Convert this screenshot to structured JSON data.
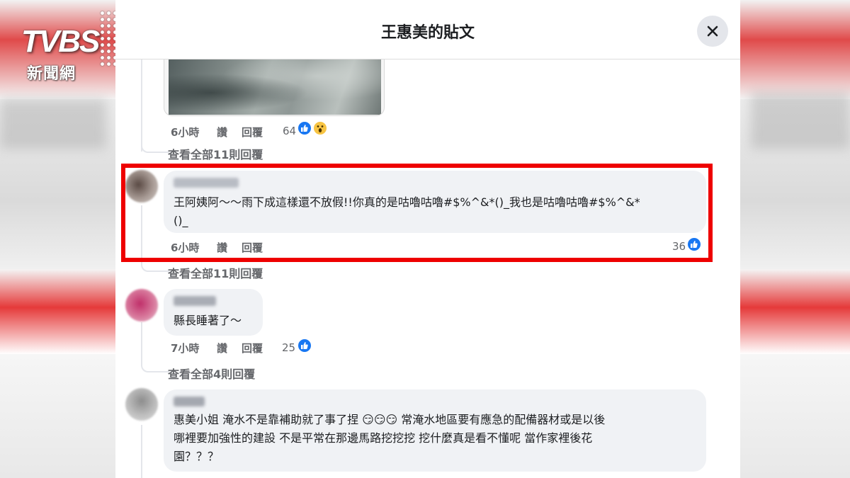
{
  "logo": {
    "brand": "TVBS",
    "subtitle": "新聞網"
  },
  "dialog": {
    "title": "王惠美的貼文"
  },
  "comments": [
    {
      "meta": {
        "time": "6小時",
        "like": "讚",
        "reply": "回覆"
      },
      "reactions": {
        "count": "64",
        "icons": [
          "like-icon",
          "wow-icon"
        ]
      },
      "view_replies": "查看全部11則回覆"
    },
    {
      "text_line1": "王阿姨阿～～雨下成這樣還不放假!!你真的是咕嚕咕嚕#$%^&*()_我也是咕嚕咕嚕#$%^&*",
      "text_line2": "()_",
      "meta": {
        "time": "6小時",
        "like": "讚",
        "reply": "回覆"
      },
      "reactions": {
        "count": "36",
        "icons": [
          "like-icon"
        ]
      },
      "view_replies": "查看全部11則回覆"
    },
    {
      "text_line1": "縣長睡著了～",
      "meta": {
        "time": "7小時",
        "like": "讚",
        "reply": "回覆"
      },
      "reactions": {
        "count": "25",
        "icons": [
          "like-icon"
        ]
      },
      "view_replies": "查看全部4則回覆"
    },
    {
      "text_line1": "惠美小姐 淹水不是靠補助就了事了捏 😏😏😏 常淹水地區要有應急的配備器材或是以後",
      "text_line2": "哪裡要加強性的建設 不是平常在那邊馬路挖挖挖 挖什麼真是看不懂呢 當作家裡後花",
      "text_line3": "園？？？"
    }
  ],
  "colors": {
    "highlight": "#ee0000",
    "like": "#1877f2",
    "bubble": "#f0f2f5",
    "meta": "#65676b"
  }
}
